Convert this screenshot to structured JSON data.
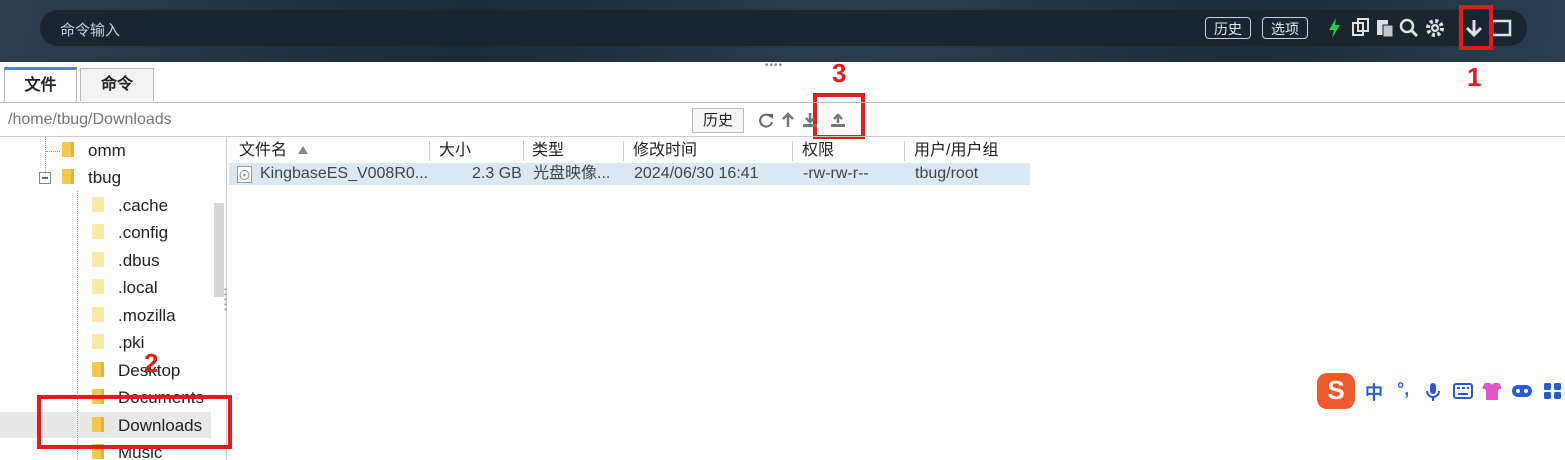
{
  "top": {
    "command_placeholder": "命令输入",
    "history_label": "历史",
    "options_label": "选项"
  },
  "annotations": {
    "n1": "1",
    "n2": "2",
    "n3": "3"
  },
  "tabs": [
    {
      "label": "文件",
      "active": true
    },
    {
      "label": "命令",
      "active": false
    }
  ],
  "pathbar": {
    "path": "/home/tbug/Downloads",
    "history_label": "历史"
  },
  "tree": {
    "items": [
      "omm",
      "tbug",
      ".cache",
      ".config",
      ".dbus",
      ".local",
      ".mozilla",
      ".pki",
      "Desktop",
      "Documents",
      "Downloads",
      "Music"
    ],
    "selected": "Downloads"
  },
  "file_list": {
    "columns": [
      "文件名",
      "大小",
      "类型",
      "修改时间",
      "权限",
      "用户/用户组"
    ],
    "rows": [
      {
        "name": "KingbaseES_V008R0...",
        "size": "2.3 GB",
        "type": "光盘映像...",
        "modified": "2024/06/30 16:41",
        "perms": "-rw-rw-r--",
        "owner": "tbug/root"
      }
    ]
  },
  "ime": {
    "brand": "S",
    "items": [
      "中",
      "°,"
    ]
  },
  "colors": {
    "accent_red": "#e8191a",
    "tab_accent": "#3d8fd8",
    "green_bolt": "#2ecc40",
    "topbar": "#1a2530"
  }
}
